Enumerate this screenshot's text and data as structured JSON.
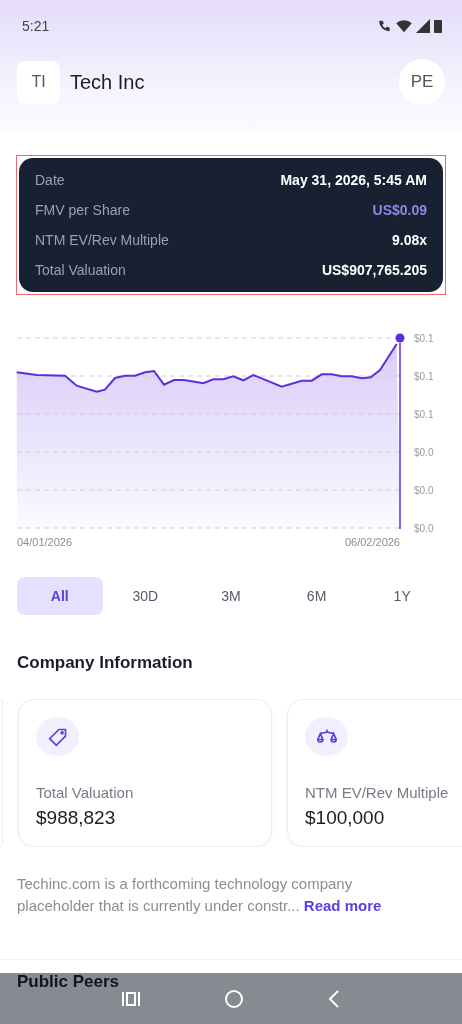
{
  "status_bar": {
    "time": "5:21"
  },
  "header": {
    "logo": "TI",
    "company": "Tech Inc",
    "avatar": "PE"
  },
  "tooltip": {
    "rows": [
      {
        "label": "Date",
        "value": "May 31, 2026, 5:45 AM",
        "kind": "plain"
      },
      {
        "label": "FMV per Share",
        "value": "US$0.09",
        "kind": "accent"
      },
      {
        "label": "NTM EV/Rev Multiple",
        "value": "9.08x",
        "kind": "plain"
      },
      {
        "label": "Total Valuation",
        "value": "US$907,765.205",
        "kind": "plain"
      }
    ]
  },
  "chart": {
    "y_tick_labels": [
      "$0.1",
      "$0.1",
      "$0.1",
      "$0.0",
      "$0.0",
      "$0.0"
    ],
    "x_labels": [
      "04/01/2026",
      "06/02/2026"
    ]
  },
  "range_tabs": [
    {
      "label": "All",
      "selected": true
    },
    {
      "label": "30D",
      "selected": false
    },
    {
      "label": "3M",
      "selected": false
    },
    {
      "label": "6M",
      "selected": false
    },
    {
      "label": "1Y",
      "selected": false
    }
  ],
  "company_info": {
    "title": "Company Information",
    "cards": [
      {
        "kind": "tag",
        "label": "Total Valuation",
        "value": "$988,823"
      },
      {
        "kind": "scales",
        "label": "NTM EV/Rev Multiple",
        "value": "$100,000"
      }
    ],
    "description": "Techinc.com is a forthcoming technology company placeholder that is currently under constr...",
    "link": "Read more"
  },
  "next_section": {
    "title": "Public Peers"
  }
}
